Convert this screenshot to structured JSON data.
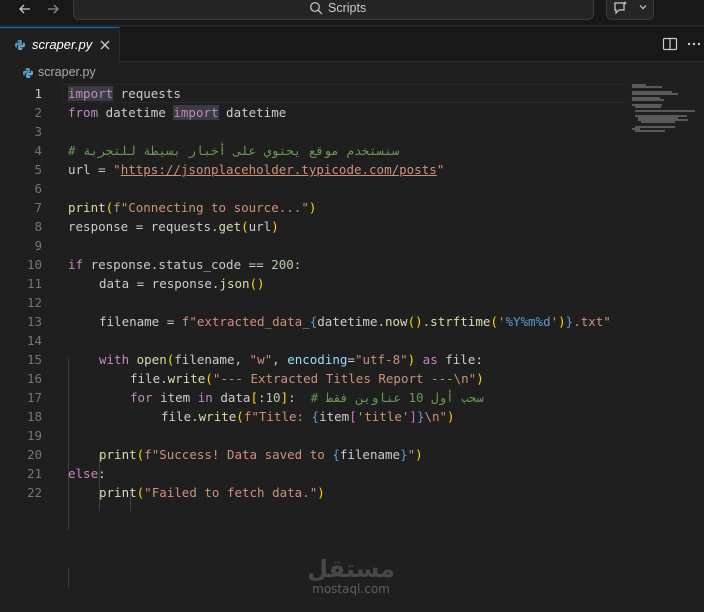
{
  "titlebar": {
    "search_label": "Scripts",
    "back_icon": "arrow-left-icon",
    "forward_icon": "arrow-right-icon",
    "copilot_icon": "copilot-chat-icon"
  },
  "tabs": [
    {
      "label": "scraper.py",
      "icon": "python-file-icon",
      "active": true
    }
  ],
  "breadcrumb": {
    "file": "scraper.py"
  },
  "editor": {
    "active_line": 1,
    "line_numbers": [
      "1",
      "2",
      "3",
      "4",
      "5",
      "6",
      "7",
      "8",
      "9",
      "10",
      "11",
      "12",
      "13",
      "14",
      "15",
      "16",
      "17",
      "18",
      "19",
      "20",
      "21",
      "22"
    ],
    "tokens": {
      "l1_import": "import",
      "l1_requests": " requests",
      "l2_from": "from",
      "l2_datetime": " datetime ",
      "l2_import": "import",
      "l2_datetime2": " datetime",
      "l4_comment": "# سنستخدم موقع يحتوي على أخبار بسيطة للتجربة",
      "l5_url_var": "url = ",
      "l5_q1": "\"",
      "l5_url": "https://jsonplaceholder.typicode.com/posts",
      "l5_q2": "\"",
      "l7_print": "print",
      "l7_open": "(",
      "l7_str": "f\"Connecting to source...\"",
      "l7_close": ")",
      "l8_a": "response = requests.",
      "l8_get": "get",
      "l8_open": "(",
      "l8_arg": "url",
      "l8_close": ")",
      "l10_if": "if",
      "l10_mid": " response.status_code == ",
      "l10_num": "200",
      "l10_colon": ":",
      "l11_a": "data = response.",
      "l11_json": "json",
      "l11_paren": "()",
      "l13_a": "filename = ",
      "l13_s1": "f\"extracted_data_",
      "l13_b1": "{",
      "l13_dt": "datetime.",
      "l13_now": "now",
      "l13_p1": "()",
      "l13_dot": ".",
      "l13_strf": "strftime",
      "l13_p2o": "(",
      "l13_fmt1": "'",
      "l13_fmt2": "%Y%m%d",
      "l13_fmt3": "'",
      "l13_p2c": ")",
      "l13_b2": "}",
      "l13_s2": ".txt\"",
      "l15_with": "with",
      "l15_open": " open",
      "l15_p": "(",
      "l15_fn": "filename, ",
      "l15_w": "\"w\"",
      "l15_c": ", ",
      "l15_enc": "encoding",
      "l15_eq": "=",
      "l15_utf": "\"utf-8\"",
      "l15_pc": ")",
      "l15_as": " as",
      "l15_file": " file:",
      "l16_a": "file.",
      "l16_write": "write",
      "l16_p": "(",
      "l16_str": "\"--- Extracted Titles Report ---\\n\"",
      "l16_pc": ")",
      "l17_for": "for",
      "l17_item": " item ",
      "l17_in": "in",
      "l17_data": " data",
      "l17_br": "[",
      "l17_slice": ":",
      "l17_num": "10",
      "l17_brc": "]",
      "l17_colon": ":  ",
      "l17_cmt": "# سحب أول 10 عناوين فقط",
      "l18_a": "file.",
      "l18_write": "write",
      "l18_p": "(",
      "l18_s1": "f\"Title: ",
      "l18_b1": "{",
      "l18_item": "item",
      "l18_br": "[",
      "l18_key": "'title'",
      "l18_brc": "]",
      "l18_b2": "}",
      "l18_s2": "\\n\"",
      "l18_pc": ")",
      "l20_print": "print",
      "l20_p": "(",
      "l20_s1": "f\"Success! Data saved to ",
      "l20_b1": "{",
      "l20_fn": "filename",
      "l20_b2": "}",
      "l20_s2": "\"",
      "l20_pc": ")",
      "l21_else": "else",
      "l21_colon": ":",
      "l22_print": "print",
      "l22_p": "(",
      "l22_str": "\"Failed to fetch data.\"",
      "l22_pc": ")"
    }
  },
  "watermark": {
    "arabic": "مستقل",
    "latin": "mostaql.com"
  },
  "colors": {
    "editor_bg": "#1f1f1f",
    "keyword": "#c586c0",
    "control_keyword": "#569cd6",
    "function": "#dcdcaa",
    "string": "#ce9178",
    "number": "#b5cea8",
    "comment": "#6a9955",
    "variable": "#9cdcfe",
    "accent": "#0078d4"
  }
}
